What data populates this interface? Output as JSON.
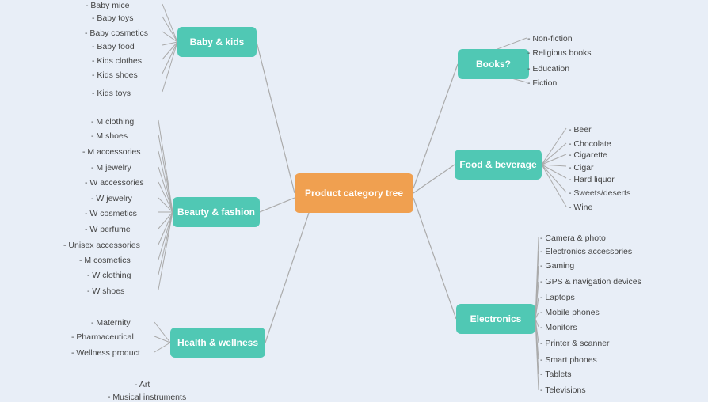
{
  "title": "Product category tree",
  "center": "Product category tree",
  "nodes": {
    "baby": "Baby & kids",
    "books": "Books?",
    "food": "Food & beverage",
    "electronics": "Electronics",
    "beauty": "Beauty & fashion",
    "health": "Health & wellness"
  },
  "baby_items": [
    "Baby mice",
    "Baby toys",
    "Baby cosmetics",
    "Baby food",
    "Kids clothes",
    "Kids shoes",
    "Kids toys"
  ],
  "books_items": [
    "Non-fiction",
    "Religious books",
    "Education",
    "Fiction"
  ],
  "food_items": [
    "Beer",
    "Chocolate",
    "Cigarette",
    "Cigar",
    "Hard liquor",
    "Sweets/deserts",
    "Wine"
  ],
  "electronics_items": [
    "Camera &amp; photo",
    "Electronics accessories",
    "Gaming",
    "GPS &amp; navigation devices",
    "Laptops",
    "Mobile phones",
    "Monitors",
    "Printer &amp; scanner",
    "Smart phones",
    "Tablets",
    "Televisions"
  ],
  "beauty_items": [
    "M clothing",
    "M shoes",
    "M accessories",
    "M jewelry",
    "W accessories",
    "W jewelry",
    "W cosmetics",
    "W perfume",
    "Unisex accessories",
    "M cosmetics",
    "W clothing",
    "W shoes"
  ],
  "health_items": [
    "Maternity",
    "Pharmaceutical",
    "Wellness product"
  ],
  "other_items": [
    "Art",
    "Musical instruments"
  ]
}
